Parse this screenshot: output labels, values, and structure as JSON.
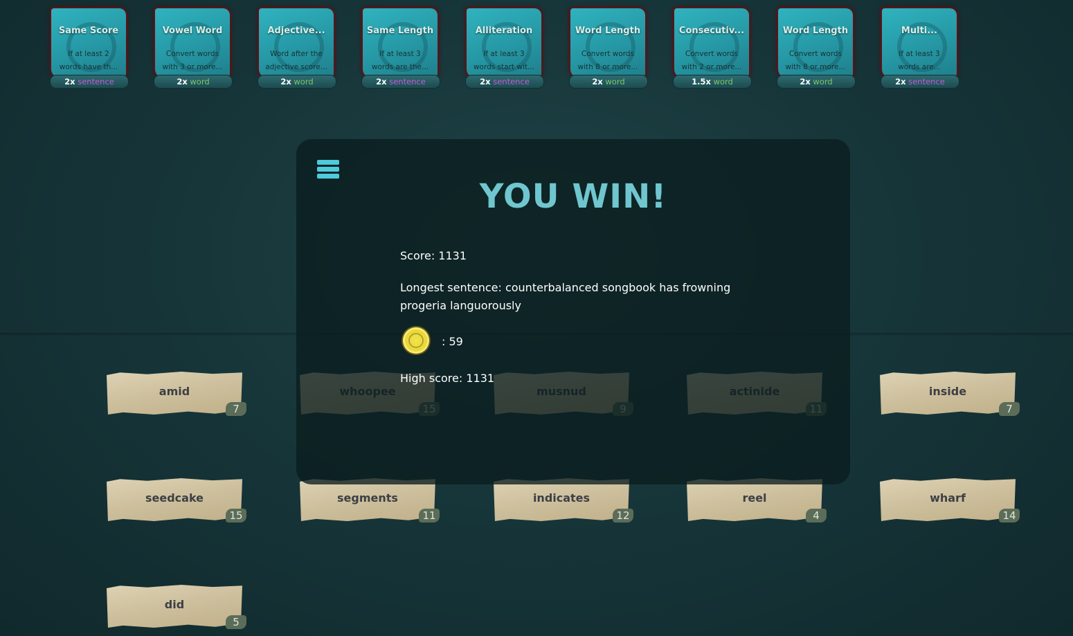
{
  "jokers": [
    {
      "title": "Same Score",
      "desc_line1": "If at least 2",
      "desc_line2": "words have th...",
      "mult": "2x",
      "type": "sentence"
    },
    {
      "title": "Vowel Word",
      "desc_line1": "Convert words",
      "desc_line2": "with 3 or more...",
      "mult": "2x",
      "type": "word"
    },
    {
      "title": "Adjective...",
      "desc_line1": "Word after the",
      "desc_line2": "adjective score...",
      "mult": "2x",
      "type": "word"
    },
    {
      "title": "Same Length",
      "desc_line1": "If at least 3",
      "desc_line2": "words are the...",
      "mult": "2x",
      "type": "sentence"
    },
    {
      "title": "Alliteration",
      "desc_line1": "If at least 3",
      "desc_line2": "words start wit...",
      "mult": "2x",
      "type": "sentence"
    },
    {
      "title": "Word Length",
      "desc_line1": "Convert words",
      "desc_line2": "with 8 or more...",
      "mult": "2x",
      "type": "word"
    },
    {
      "title": "Consecutiv...",
      "desc_line1": "Convert words",
      "desc_line2": "with 2 or more...",
      "mult": "1.5x",
      "type": "word"
    },
    {
      "title": "Word Length",
      "desc_line1": "Convert words",
      "desc_line2": "with 8 or more...",
      "mult": "2x",
      "type": "word"
    },
    {
      "title": "Multi...",
      "desc_line1": "If at least 3",
      "desc_line2": "words are...",
      "mult": "2x",
      "type": "sentence"
    }
  ],
  "words": [
    {
      "text": "amid",
      "score": "7"
    },
    {
      "text": "whoopee",
      "score": "15"
    },
    {
      "text": "musnud",
      "score": "9"
    },
    {
      "text": "actinide",
      "score": "11"
    },
    {
      "text": "inside",
      "score": "7"
    },
    {
      "text": "seedcake",
      "score": "15"
    },
    {
      "text": "segments",
      "score": "11"
    },
    {
      "text": "indicates",
      "score": "12"
    },
    {
      "text": "reel",
      "score": "4"
    },
    {
      "text": "wharf",
      "score": "14"
    },
    {
      "text": "did",
      "score": "5"
    }
  ],
  "win": {
    "title": "YOU WIN!",
    "score": "Score: 1131",
    "longest_line1": "Longest sentence:  counterbalanced songbook has frowning",
    "longest_line2": "progeria languorously",
    "coins": ": 59",
    "high_score": "High score: 1131"
  },
  "colors": {
    "sentence": "#c45bd6",
    "word": "#7ec76a",
    "title": "#6fc6cf",
    "menu_icon": "#4fc9dc"
  },
  "icons": {
    "menu": "hamburger-menu-icon",
    "coin": "gold-coin-icon"
  }
}
